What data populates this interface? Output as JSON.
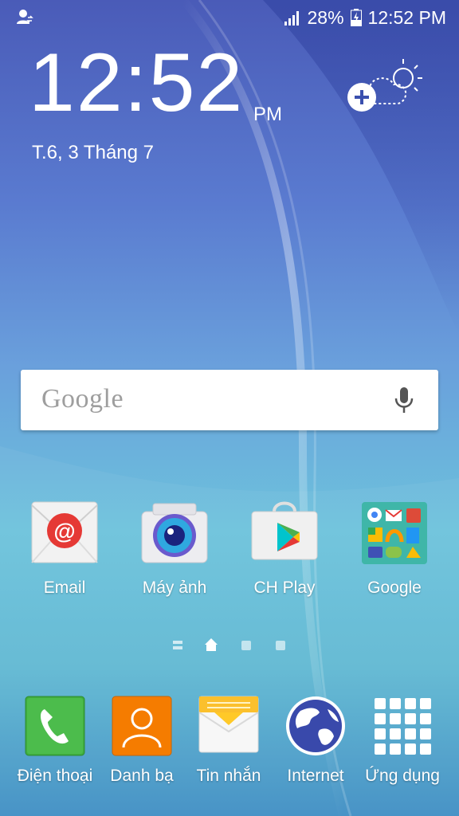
{
  "status_bar": {
    "left_icon": "user-switch-icon",
    "signal_icon": "signal-icon",
    "battery_percent": "28%",
    "battery_icon": "battery-charging-icon",
    "time": "12:52 PM"
  },
  "clock_widget": {
    "time": "12:52",
    "ampm": "PM",
    "date": "T.6, 3 Tháng 7",
    "weather_icon": "add-weather-icon"
  },
  "search": {
    "logo": "Google",
    "mic_icon": "mic-icon"
  },
  "apps": [
    {
      "label": "Email",
      "icon": "email-icon"
    },
    {
      "label": "Máy ảnh",
      "icon": "camera-icon"
    },
    {
      "label": "CH Play",
      "icon": "play-store-icon"
    },
    {
      "label": "Google",
      "icon": "google-folder-icon"
    }
  ],
  "page_indicator": {
    "pages": [
      "menu",
      "home",
      "page",
      "page"
    ],
    "current": 1
  },
  "dock": [
    {
      "label": "Điện thoại",
      "icon": "phone-icon"
    },
    {
      "label": "Danh bạ",
      "icon": "contacts-icon"
    },
    {
      "label": "Tin nhắn",
      "icon": "messages-icon"
    },
    {
      "label": "Internet",
      "icon": "globe-icon"
    },
    {
      "label": "Ứng dụng",
      "icon": "apps-grid-icon"
    }
  ],
  "colors": {
    "phone_green": "#4caf50",
    "contacts_orange": "#f57c00",
    "messages_yellow": "#fbc02d",
    "internet_blue": "#3949ab",
    "email_red": "#e53935"
  }
}
